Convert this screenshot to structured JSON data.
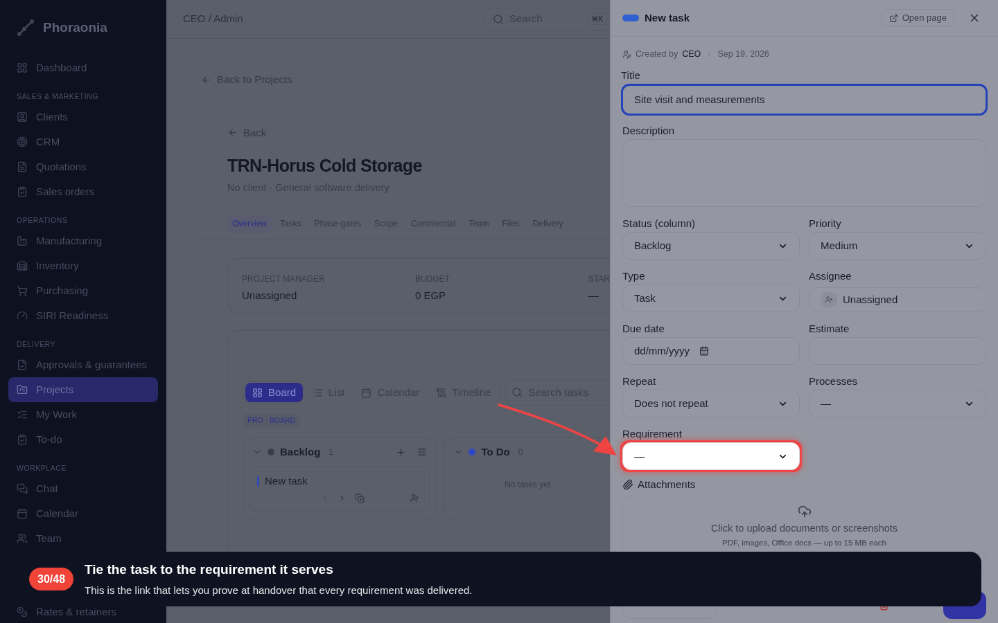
{
  "sidebar": {
    "brand": "Phoraonia",
    "sections": [
      {
        "items": [
          {
            "label": "Dashboard",
            "selected": false
          }
        ]
      },
      {
        "heading": "SALES & MARKETING",
        "items": [
          {
            "label": "Clients",
            "selected": false
          },
          {
            "label": "CRM",
            "selected": false
          },
          {
            "label": "Quotations",
            "selected": false
          },
          {
            "label": "Sales orders",
            "selected": false
          }
        ]
      },
      {
        "heading": "OPERATIONS",
        "items": [
          {
            "label": "Manufacturing",
            "selected": false
          },
          {
            "label": "Inventory",
            "selected": false
          },
          {
            "label": "Purchasing",
            "selected": false
          },
          {
            "label": "SIRI Readiness",
            "selected": false
          }
        ]
      },
      {
        "heading": "DELIVERY",
        "items": [
          {
            "label": "Approvals & guarantees",
            "selected": false
          },
          {
            "label": "Projects",
            "selected": true
          },
          {
            "label": "My Work",
            "selected": false
          },
          {
            "label": "To-do",
            "selected": false
          }
        ]
      },
      {
        "heading": "WORKPLACE",
        "items": [
          {
            "label": "Chat",
            "selected": false
          },
          {
            "label": "Calendar",
            "selected": false
          },
          {
            "label": "Team",
            "selected": false
          }
        ]
      }
    ],
    "footer_item": {
      "label": "Rates & retainers",
      "selected": false
    }
  },
  "header": {
    "breadcrumb": "CEO / Admin",
    "search": {
      "placeholder": "Search",
      "shortcut": "⌘K"
    }
  },
  "project": {
    "back_to_projects": "Back to Projects",
    "back": "Back",
    "title": "TRN-Horus Cold Storage",
    "subtitle": "No client · General software delivery",
    "tabs": [
      {
        "label": "Overview",
        "selected": true
      },
      {
        "label": "Tasks",
        "selected": false
      },
      {
        "label": "Phase-gates",
        "selected": false
      },
      {
        "label": "Scope",
        "selected": false
      },
      {
        "label": "Commercial",
        "selected": false
      },
      {
        "label": "Team",
        "selected": false
      },
      {
        "label": "Files",
        "selected": false
      },
      {
        "label": "Delivery",
        "selected": false
      }
    ],
    "summary": [
      {
        "label": "PROJECT MANAGER",
        "value": "Unassigned"
      },
      {
        "label": "BUDGET",
        "value": "0 EGP"
      },
      {
        "label": "STAR",
        "value": "—"
      }
    ],
    "views": [
      {
        "label": "Board",
        "selected": true
      },
      {
        "label": "List",
        "selected": false
      },
      {
        "label": "Calendar",
        "selected": false
      },
      {
        "label": "Timeline",
        "selected": false
      }
    ],
    "task_search": {
      "placeholder": "Search tasks"
    },
    "board_tag": "PRO · BOARD",
    "columns": [
      {
        "name": "Backlog",
        "count": "1",
        "color": "#3a3e4a",
        "cards": [
          {
            "title": "New task"
          }
        ]
      },
      {
        "name": "To Do",
        "count": "0",
        "color": "#2f48c8",
        "empty": "No tasks yet"
      }
    ]
  },
  "drawer": {
    "color": "#2f5fd0",
    "title": "New task",
    "open_page": "Open page",
    "meta": {
      "prefix": "Created by",
      "author": "CEO",
      "separator": "·",
      "date": "Sep 19, 2026"
    },
    "title_field": {
      "label": "Title",
      "kind": "text",
      "value": "Site visit and measurements",
      "focused": true,
      "highlighted": false
    },
    "description_field": {
      "label": "Description",
      "kind": "textarea",
      "focused": false,
      "highlighted": false
    },
    "rows": [
      [
        {
          "label": "Status (column)",
          "kind": "select",
          "value": "Backlog",
          "focused": false,
          "highlighted": false
        },
        {
          "label": "Priority",
          "kind": "select",
          "value": "Medium",
          "focused": false,
          "highlighted": false
        }
      ],
      [
        {
          "label": "Type",
          "kind": "select",
          "value": "Task",
          "focused": false,
          "highlighted": false
        },
        {
          "label": "Assignee",
          "kind": "person",
          "value": "Unassigned",
          "focused": false,
          "highlighted": false
        }
      ],
      [
        {
          "label": "Due date",
          "kind": "date",
          "placeholder": "dd/mm/yyyy",
          "focused": false,
          "highlighted": false
        },
        {
          "label": "Estimate",
          "kind": "text",
          "focused": false,
          "highlighted": false
        }
      ],
      [
        {
          "label": "Repeat",
          "kind": "select",
          "value": "Does not repeat",
          "focused": false,
          "highlighted": false
        },
        {
          "label": "Processes",
          "kind": "select",
          "value": "—",
          "focused": false,
          "highlighted": false
        }
      ],
      [
        {
          "label": "Requirement",
          "kind": "select",
          "value": "—",
          "focused": false,
          "highlighted": true
        }
      ]
    ],
    "attachments": {
      "label": "Attachments",
      "upload": "Click to upload documents or screenshots",
      "hint": "PDF, images, Office docs — up to 15 MB each"
    },
    "footer": [
      {
        "kind": "secondary"
      },
      {
        "kind": "danger"
      },
      {
        "kind": "primary"
      }
    ]
  },
  "tour": {
    "step": "30/48",
    "title": "Tie the task to the requirement it serves",
    "body": "This is the link that lets you prove at handover that every requirement was delivered."
  }
}
